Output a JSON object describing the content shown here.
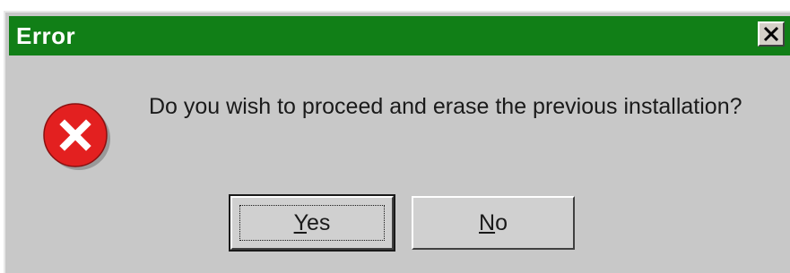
{
  "window": {
    "title": "Error",
    "close_glyph": "✕"
  },
  "icon": {
    "name": "error-icon",
    "color": "#e32020"
  },
  "message": "Do you wish to proceed and erase the previous installation?",
  "buttons": {
    "yes": {
      "mnemonic": "Y",
      "rest": "es"
    },
    "no": {
      "mnemonic": "N",
      "rest": "o"
    }
  },
  "colors": {
    "titlebar": "#117f17",
    "dialog_bg": "#c8c8c8"
  }
}
